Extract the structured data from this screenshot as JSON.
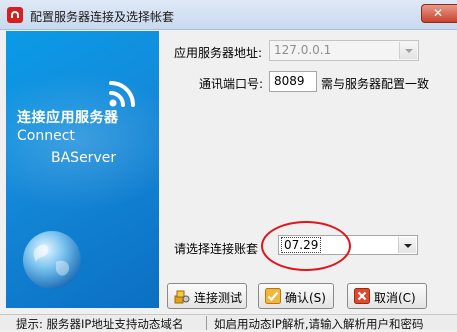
{
  "window": {
    "title": "配置服务器连接及选择帐套",
    "close_glyph": "✕"
  },
  "brand": {
    "cn": "连接应用服务器",
    "en_line1": "Connect",
    "en_line2": "BAServer"
  },
  "form": {
    "server_label": "应用服务器地址:",
    "server_value": "127.0.0.1",
    "port_label": "通讯端口号:",
    "port_value": "8089",
    "port_hint": "需与服务器配置一致",
    "account_label": "请选择连接账套",
    "account_value": "07.29"
  },
  "buttons": {
    "test": "连接测试",
    "ok": "确认(S)",
    "cancel": "取消(C)"
  },
  "status": {
    "left": "提示: 服务器IP地址支持动态域名",
    "right": "如启用动态IP解析,请输入解析用户和密码"
  },
  "colors": {
    "annotation": "#e0141a",
    "panel": "#1488d8"
  }
}
